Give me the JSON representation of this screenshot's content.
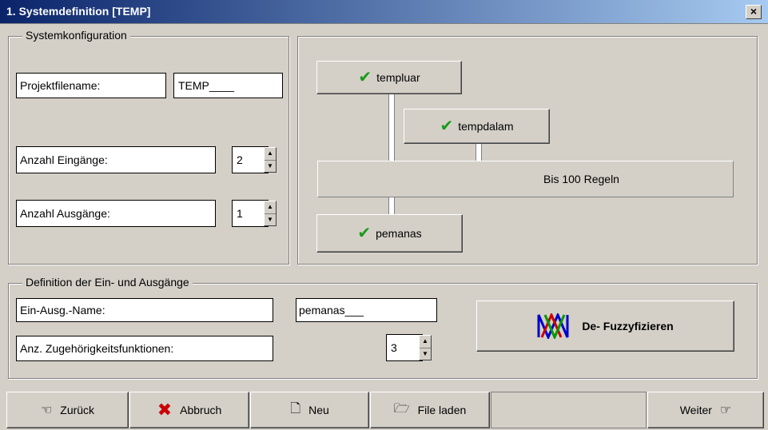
{
  "window": {
    "title": "1. Systemdefinition [TEMP]",
    "close_glyph": "×"
  },
  "system_config": {
    "legend": "Systemkonfiguration",
    "project_label": "Projektfilename:",
    "project_value": "TEMP____",
    "inputs_label": "Anzahl Eingänge:",
    "inputs_value": "2",
    "outputs_label": "Anzahl Ausgänge:",
    "outputs_value": "1"
  },
  "diagram": {
    "input1": "templuar",
    "input2": "tempdalam",
    "rules": "Bis 100 Regeln",
    "output1": "pemanas"
  },
  "io_definition": {
    "legend": "Definition der Ein- und Ausgänge",
    "name_label": "Ein-Ausg.-Name:",
    "name_value": "pemanas___",
    "count_label": "Anz. Zugehörigkeitsfunktionen:",
    "count_value": "3",
    "fuzzify_button": "De- Fuzzyfizieren"
  },
  "toolbar": {
    "back": "Zurück",
    "cancel": "Abbruch",
    "new": "Neu",
    "load": "File laden",
    "next": "Weiter"
  },
  "colors": {
    "titlebar_start": "#0a246a",
    "titlebar_end": "#a6caf0",
    "check_green": "#1a9a1a",
    "cancel_red": "#cc0000"
  }
}
